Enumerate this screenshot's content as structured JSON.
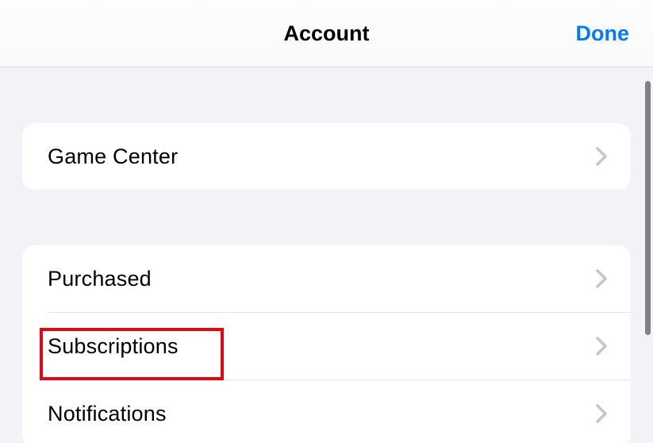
{
  "nav": {
    "title": "Account",
    "done": "Done"
  },
  "groups": [
    {
      "id": "game-center-group",
      "rows": [
        {
          "id": "game-center",
          "label": "Game Center"
        }
      ]
    },
    {
      "id": "purchases-group",
      "rows": [
        {
          "id": "purchased",
          "label": "Purchased"
        },
        {
          "id": "subscriptions",
          "label": "Subscriptions"
        },
        {
          "id": "notifications",
          "label": "Notifications"
        }
      ]
    }
  ]
}
